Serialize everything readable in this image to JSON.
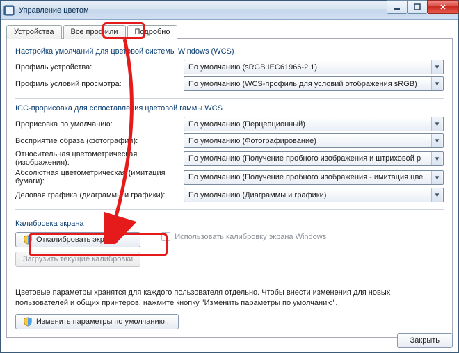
{
  "window": {
    "title": "Управление цветом"
  },
  "tabs": {
    "devices": "Устройства",
    "all_profiles": "Все профили",
    "advanced": "Подробно"
  },
  "wcs": {
    "heading": "Настройка умолчаний для цветовой системы Windows (WCS)",
    "device_profile_label": "Профиль устройства:",
    "device_profile_value": "По умолчанию (sRGB IEC61966-2.1)",
    "viewing_label": "Профиль условий просмотра:",
    "viewing_value": "По умолчанию (WCS-профиль для условий отображения sRGB)"
  },
  "icc": {
    "heading": "ICC-прорисовка для сопоставления цветовой гаммы WCS",
    "default_label": "Прорисовка по умолчанию:",
    "default_value": "По умолчанию (Перцепционный)",
    "photo_label": "Восприятие образа (фотографии):",
    "photo_value": "По умолчанию (Фотографирование)",
    "relcol_label": "Относительная цветометрическая (изображения):",
    "relcol_value": "По умолчанию (Получение пробного изображения и штриховой р",
    "abscol_label": "Абсолютная цветометрическая (имитация бумаги):",
    "abscol_value": "По умолчанию (Получение пробного изображения - имитация цве",
    "business_label": "Деловая графика (диаграммы и графики):",
    "business_value": "По умолчанию (Диаграммы и графики)"
  },
  "calib": {
    "heading": "Калибровка экрана",
    "calibrate_btn": "Откалибровать экран",
    "reload_btn": "Загрузить текущие калибровки",
    "checkbox": "Использовать калибровку экрана Windows"
  },
  "note": "Цветовые параметры хранятся для каждого пользователя отдельно. Чтобы внести изменения для новых пользователей и общих принтеров, нажмите кнопку \"Изменить параметры по умолчанию\".",
  "change_defaults_btn": "Изменить параметры по умолчанию...",
  "close_btn": "Закрыть"
}
